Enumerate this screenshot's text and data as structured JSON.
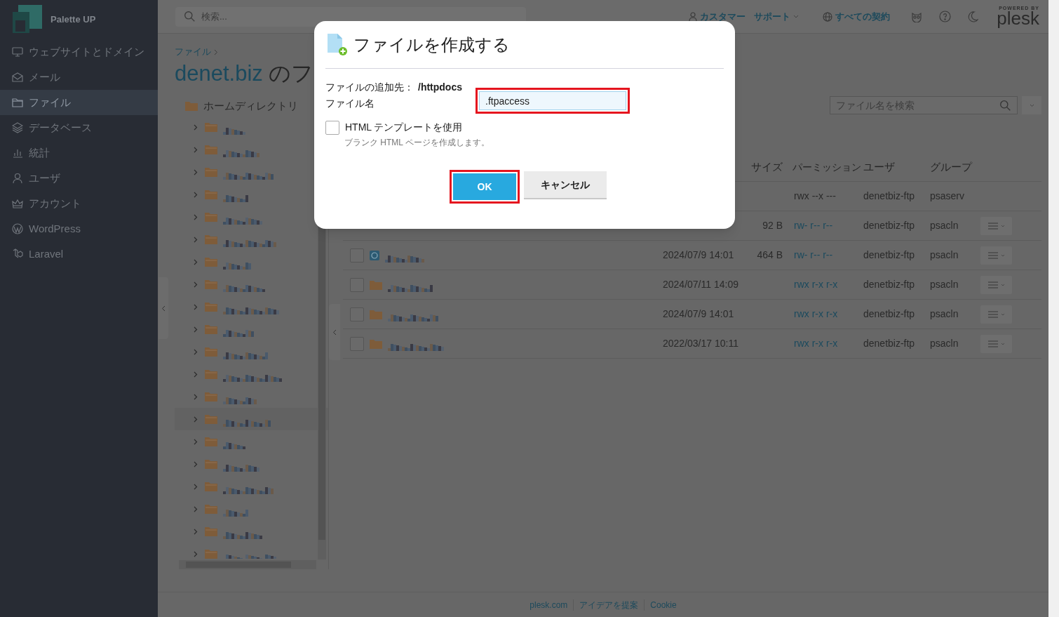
{
  "sidebar": {
    "brand": "Palette UP",
    "items": [
      {
        "label": "ウェブサイトとドメイン",
        "selected": false
      },
      {
        "label": "メール",
        "selected": false
      },
      {
        "label": "ファイル",
        "selected": true
      },
      {
        "label": "データベース",
        "selected": false
      },
      {
        "label": "統計",
        "selected": false
      },
      {
        "label": "ユーザ",
        "selected": false
      },
      {
        "label": "アカウント",
        "selected": false
      },
      {
        "label": "WordPress",
        "selected": false
      },
      {
        "label": "Laravel",
        "selected": false
      }
    ]
  },
  "topbar": {
    "search_placeholder": "検索...",
    "customer": "カスタマー",
    "support": "サポート",
    "subscriptions": "すべての契約",
    "powered_by": "POWERED BY",
    "product": "plesk"
  },
  "page": {
    "breadcrumb": "ファイル",
    "title_domain": "denet.biz",
    "title_rest": "のフ"
  },
  "tree": {
    "root": "ホームディレクトリ",
    "children": [
      {
        "expanded": false
      },
      {
        "expanded": false
      },
      {
        "expanded": false
      },
      {
        "expanded": false
      },
      {
        "expanded": false
      },
      {
        "expanded": false
      },
      {
        "expanded": false
      },
      {
        "expanded": false
      },
      {
        "expanded": false
      },
      {
        "expanded": false
      },
      {
        "expanded": false
      },
      {
        "expanded": false
      },
      {
        "expanded": false
      },
      {
        "expanded": false
      },
      {
        "expanded": false
      },
      {
        "expanded": false
      },
      {
        "expanded": false
      },
      {
        "expanded": false
      },
      {
        "expanded": false
      },
      {
        "expanded": false
      }
    ]
  },
  "file_search": {
    "placeholder": "ファイル名を検索"
  },
  "table": {
    "columns": [
      "サイズ",
      "パーミッション",
      "ユーザ",
      "グループ"
    ],
    "rows": [
      {
        "kind": "hidden",
        "date": "",
        "size": "",
        "permissions": "rwx --x ---",
        "editable": false,
        "user": "denetbiz-ftp",
        "group": "psaserv"
      },
      {
        "kind": "covered",
        "date": "",
        "size": "92 B",
        "permissions": "rw- r-- r--",
        "editable": true,
        "user": "denetbiz-ftp",
        "group": "psacln"
      },
      {
        "kind": "file",
        "checked": false,
        "date": "2024/07/9 14:01",
        "size": "464 B",
        "permissions": "rw- r-- r--",
        "editable": true,
        "user": "denetbiz-ftp",
        "group": "psacln"
      },
      {
        "kind": "folder",
        "checked": false,
        "date": "2024/07/11 14:09",
        "size": "",
        "permissions": "rwx r-x r-x",
        "editable": true,
        "user": "denetbiz-ftp",
        "group": "psacln"
      },
      {
        "kind": "folder",
        "checked": false,
        "date": "2024/07/9 14:01",
        "size": "",
        "permissions": "rwx r-x r-x",
        "editable": true,
        "user": "denetbiz-ftp",
        "group": "psacln"
      },
      {
        "kind": "folder",
        "checked": false,
        "date": "2022/03/17 10:11",
        "size": "",
        "permissions": "rwx r-x r-x",
        "editable": true,
        "user": "denetbiz-ftp",
        "group": "psacln"
      }
    ]
  },
  "dialog": {
    "title": "ファイルを作成する",
    "destination_label": "ファイルの追加先：",
    "destination": "/httpdocs",
    "name_label": "ファイル名",
    "name_value": ".ftpaccess",
    "name_highlighted": true,
    "template": {
      "label": "HTML テンプレートを使用",
      "hint": "ブランク HTML ページを作成します。",
      "checked": false
    },
    "buttons": [
      {
        "label": "OK",
        "kind": "primary",
        "highlighted": true
      },
      {
        "label": "キャンセル",
        "kind": "secondary",
        "highlighted": false
      }
    ]
  },
  "footer": {
    "links": [
      "plesk.com",
      "アイデアを提案",
      "Cookie"
    ]
  }
}
